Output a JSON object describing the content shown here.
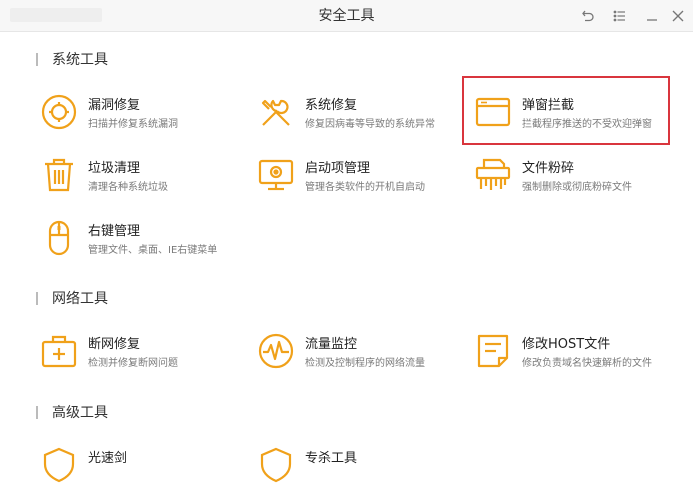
{
  "window": {
    "title": "安全工具"
  },
  "colors": {
    "accent": "#f0a11a",
    "highlight_border": "#d9353d"
  },
  "sections": {
    "system": {
      "label": "系统工具",
      "tools": [
        {
          "name": "漏洞修复",
          "desc": "扫描并修复系统漏洞",
          "icon": "vulnerability-repair-icon"
        },
        {
          "name": "系统修复",
          "desc": "修复因病毒等导致的系统异常",
          "icon": "wrench-screwdriver-icon"
        },
        {
          "name": "弹窗拦截",
          "desc": "拦截程序推送的不受欢迎弹窗",
          "icon": "popup-window-icon"
        },
        {
          "name": "垃圾清理",
          "desc": "清理各种系统垃圾",
          "icon": "trash-can-icon"
        },
        {
          "name": "启动项管理",
          "desc": "管理各类软件的开机自启动",
          "icon": "monitor-startup-icon"
        },
        {
          "name": "文件粉碎",
          "desc": "强制删除或彻底粉碎文件",
          "icon": "shredder-icon"
        },
        {
          "name": "右键管理",
          "desc": "管理文件、桌面、IE右键菜单",
          "icon": "mouse-icon"
        }
      ]
    },
    "network": {
      "label": "网络工具",
      "tools": [
        {
          "name": "断网修复",
          "desc": "检测并修复断网问题",
          "icon": "first-aid-kit-icon"
        },
        {
          "name": "流量监控",
          "desc": "检测及控制程序的网络流量",
          "icon": "traffic-monitor-icon"
        },
        {
          "name": "修改HOST文件",
          "desc": "修改负责域名快速解析的文件",
          "icon": "host-file-icon"
        }
      ]
    },
    "advanced": {
      "label": "高级工具",
      "tools": [
        {
          "name": "光速剑",
          "desc": "",
          "icon": "shield-icon"
        },
        {
          "name": "专杀工具",
          "desc": "",
          "icon": "shield-icon"
        }
      ]
    }
  }
}
